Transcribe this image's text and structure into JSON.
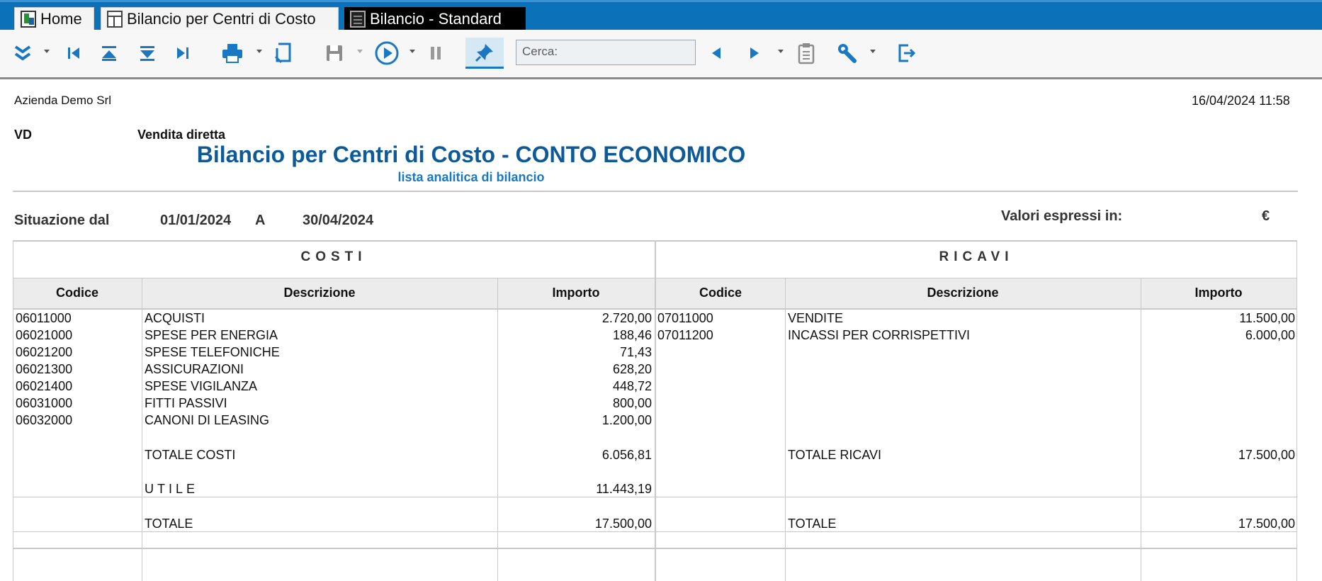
{
  "tabs": [
    {
      "label": "Home",
      "icon": "home-app-icon"
    },
    {
      "label": "Bilancio per Centri di Costo",
      "icon": "table-icon"
    },
    {
      "label": "Bilancio - Standard",
      "icon": "document-icon"
    }
  ],
  "toolbar": {
    "search_placeholder": "Cerca:"
  },
  "report": {
    "company": "Azienda Demo Srl",
    "datetime": "16/04/2024 11:58",
    "center_code": "VD",
    "center_name": "Vendita diretta",
    "title": "Bilancio per Centri di Costo - CONTO ECONOMICO",
    "subtitle": "lista analitica di bilancio",
    "situazione_label": "Situazione dal",
    "date_from": "01/01/2024",
    "a_label": "A",
    "date_to": "30/04/2024",
    "valori_label": "Valori espressi in:",
    "currency": "€"
  },
  "table": {
    "costi_title": "COSTI",
    "ricavi_title": "RICAVI",
    "headers": {
      "codice": "Codice",
      "descrizione": "Descrizione",
      "importo": "Importo"
    },
    "costi": [
      {
        "codice": "06011000",
        "descrizione": "ACQUISTI",
        "importo": "2.720,00"
      },
      {
        "codice": "06021000",
        "descrizione": "SPESE PER ENERGIA",
        "importo": "188,46"
      },
      {
        "codice": "06021200",
        "descrizione": "SPESE TELEFONICHE",
        "importo": "71,43"
      },
      {
        "codice": "06021300",
        "descrizione": "ASSICURAZIONI",
        "importo": "628,20"
      },
      {
        "codice": "06021400",
        "descrizione": "SPESE VIGILANZA",
        "importo": "448,72"
      },
      {
        "codice": "06031000",
        "descrizione": "FITTI PASSIVI",
        "importo": "800,00"
      },
      {
        "codice": "06032000",
        "descrizione": "CANONI DI LEASING",
        "importo": "1.200,00"
      }
    ],
    "ricavi": [
      {
        "codice": "07011000",
        "descrizione": "VENDITE",
        "importo": "11.500,00"
      },
      {
        "codice": "07011200",
        "descrizione": "INCASSI PER CORRISPETTIVI",
        "importo": "6.000,00"
      }
    ],
    "totale_costi_label": "TOTALE COSTI",
    "totale_costi": "6.056,81",
    "totale_ricavi_label": "TOTALE RICAVI",
    "totale_ricavi": "17.500,00",
    "utile_label": "UTILE",
    "utile": "11.443,19",
    "totale_label": "TOTALE",
    "totale_costi_finale": "17.500,00",
    "totale_ricavi_finale": "17.500,00"
  }
}
